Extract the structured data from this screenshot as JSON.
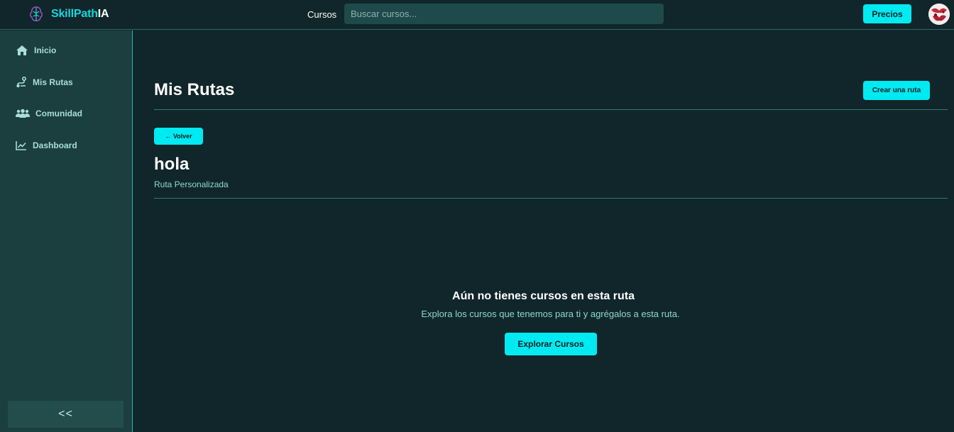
{
  "header": {
    "brand_part1": "SkillPath",
    "brand_part2": "IA",
    "nav_cursos": "Cursos",
    "search_placeholder": "Buscar cursos...",
    "precios_label": "Precios",
    "accent_color": "#00eaf2"
  },
  "sidebar": {
    "items": [
      {
        "label": "Inicio",
        "icon": "home-icon"
      },
      {
        "label": "Mis Rutas",
        "icon": "route-icon"
      },
      {
        "label": "Comunidad",
        "icon": "users-icon"
      },
      {
        "label": "Dashboard",
        "icon": "chart-line-icon"
      }
    ],
    "collapse_label": "<<"
  },
  "main": {
    "title": "Mis Rutas",
    "crear_label": "Crear una ruta",
    "volver_label": "← Volver",
    "route_name": "hola",
    "route_type": "Ruta Personalizada",
    "empty_title": "Aún no tienes cursos en esta ruta",
    "empty_desc": "Explora los cursos que tenemos para ti y agrégalos a esta ruta.",
    "explorar_label": "Explorar Cursos"
  }
}
